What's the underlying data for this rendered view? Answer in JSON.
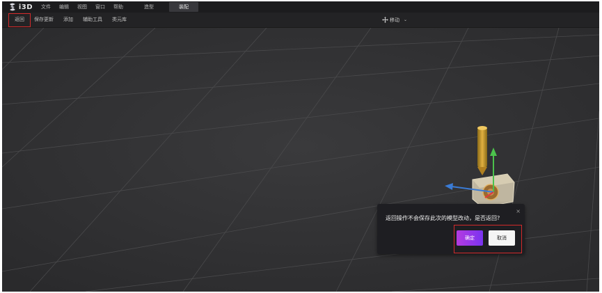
{
  "app": {
    "logo_text": "i3D"
  },
  "menu": {
    "items": [
      "文件",
      "编辑",
      "视图",
      "窗口",
      "帮助"
    ]
  },
  "modes": {
    "items": [
      "造型",
      "装配"
    ],
    "active": "装配"
  },
  "toolbar": {
    "back_label": "返回",
    "save_update_label": "保存更新",
    "add_label": "添加",
    "aux_tools_label": "辅助工具",
    "library_label": "类元库"
  },
  "transform": {
    "mode_label": "移动"
  },
  "dialog": {
    "message": "返回操作不会保存此次的模型改动，是否返回?",
    "confirm_label": "确定",
    "cancel_label": "取消",
    "close_icon": "×"
  },
  "colors": {
    "accent_gradient_start": "#b43be0",
    "accent_gradient_end": "#7a33f0",
    "highlight_red": "#d42a2a",
    "axis_x": "#3a7bd5",
    "axis_y": "#4cc24c",
    "axis_z": "#e03a3a"
  },
  "icons": {
    "logo": "logo-icon",
    "move": "move-icon",
    "dropdown": "chevron-down-icon",
    "close": "close-icon"
  }
}
